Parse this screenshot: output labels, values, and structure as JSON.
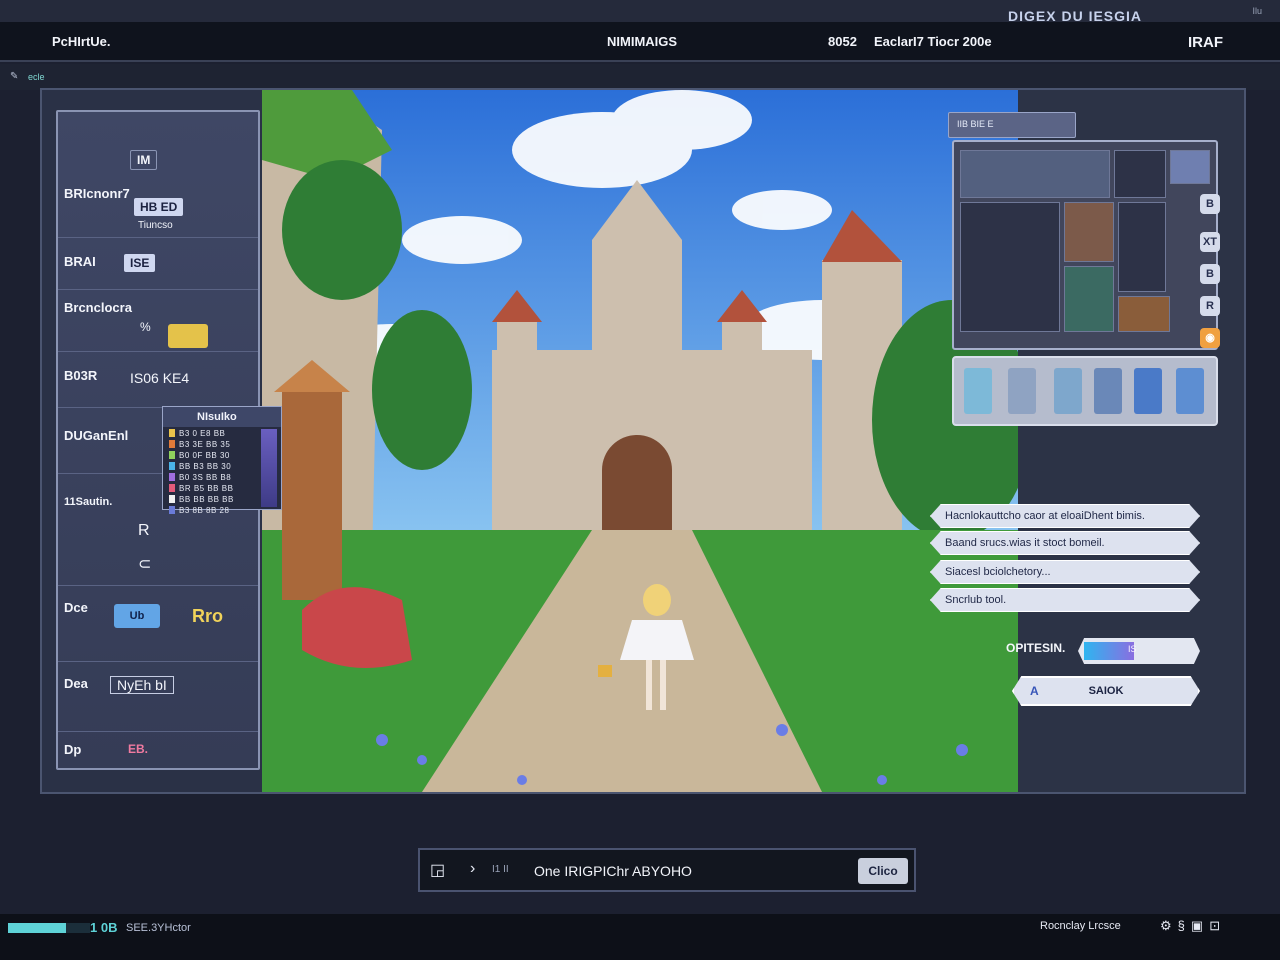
{
  "header": {
    "corner_text": "Ilu",
    "app_title": "PcHIrtUe.",
    "mode_title": "NIMIMAIGS",
    "time": "8052",
    "date": "EaclarI7 Tiocr 200e",
    "corner_title": "IRAF"
  },
  "subbar": {
    "label": "ecle"
  },
  "game": {
    "right_label": "DIGEX DU IESGIA",
    "colors": {
      "sky_top": "#2b6fd8",
      "sky_bottom": "#8ec8f2",
      "grass": "#3f9a3a",
      "path": "#c9b79a",
      "stone": "#cdbfae",
      "roof": "#b2523c"
    }
  },
  "left_panel": {
    "top_chip": "IM",
    "rows": [
      {
        "label": "BRIcnonr7",
        "chip": "HB ED",
        "sub": "Tiuncso"
      },
      {
        "label": "BRAI",
        "chip": "ISE"
      },
      {
        "label": "Brcnclocra",
        "sub": "%"
      },
      {
        "label": "B03R",
        "value": "IS06 KE4"
      },
      {
        "label": "DUGanEnl"
      },
      {
        "label": "11Sautin.",
        "icons": [
          "R",
          "⊂"
        ]
      },
      {
        "label": "Dce",
        "emblem": "Ub",
        "gold": "Rro"
      },
      {
        "label": "Dea",
        "value": "NyEh bI"
      },
      {
        "label": "Dp",
        "value": "EB."
      }
    ]
  },
  "stat_popup": {
    "title": "NIsuIko",
    "rows": [
      "B3 0 E8 BB",
      "B3 3E BB 35",
      "B0 0F BB 30",
      "BB B3 BB 30",
      "B0 3S BB B8",
      "BR B5 BB BB",
      "BB BB BB BB",
      "B3 8B 8B 28"
    ],
    "swatches": [
      "#e9c34b",
      "#e07b3a",
      "#8fd15c",
      "#4ab3e8",
      "#a06ee0",
      "#e35b7a",
      "#f1f1f1",
      "#6a7bd8"
    ]
  },
  "minimap": {
    "tab_label": "IIB BIE E",
    "side_icons": [
      "B",
      "R",
      "XT",
      "B",
      "R",
      "◉"
    ]
  },
  "dialog": {
    "options": [
      "Hacnlokauttcho caor at eloaiDhent bimis.",
      "Baand srucs.wias it stoct bomeil.",
      "Siacesl bciolchetory...",
      "Sncrlub tool."
    ],
    "options_label": "OPITESIN.",
    "options_value": "IS",
    "options_level": 0.45,
    "save_label": "SAIOK",
    "save_icon": "A"
  },
  "quest_bar": {
    "text": "One IRIGPIChr ABYOHO",
    "extra": "I1 II",
    "button_label": "Clico"
  },
  "statusbar": {
    "progress": 0.71,
    "number": "1 0B",
    "left_text": "SEE.3YHctor",
    "right_text": "Rocnclay Lrcsce",
    "icons": [
      "⚙",
      "§",
      "▣",
      "⊡"
    ]
  }
}
